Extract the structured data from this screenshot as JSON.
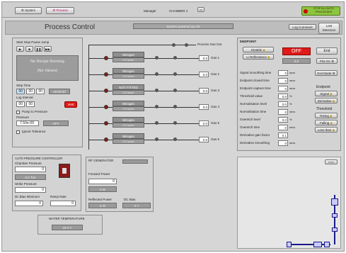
{
  "header": {
    "system_label": "System",
    "process_label": "Process",
    "manager_label": "Manager",
    "chamber": "CHAMBER 1",
    "stop_label": "STOP ALL AUTO PROCESSES"
  },
  "process": {
    "title": "Process Control",
    "status_banner": "System powered up OK",
    "log_comment": "Log Comment",
    "last_detection": "Last Detection"
  },
  "recipe": {
    "controls_label": "Start  Stop  Pause  Jump",
    "status": "No Recipe Running",
    "subtitle": "(No Values)",
    "step_time_label": "Step Time",
    "step_time": [
      "00",
      "00",
      "00"
    ],
    "step_time_total": "00:00:00",
    "log_interval_label": "Log Interval",
    "log_interval": [
      "00",
      "00"
    ],
    "vent_label": "Vent",
    "pump_label": "Pump to Pressure",
    "pressure_label": "Pressure",
    "pressure_value": "7.50e-09",
    "pressure_state": "OFF",
    "ignore_label": "Ignore Tolerance"
  },
  "gas": {
    "process_out": "Process Gas Out",
    "rows": [
      {
        "name": "Nitrogen",
        "flow": "0.0 sccm",
        "value": "0.0",
        "label": "Gas 1"
      },
      {
        "name": "Nitrogen",
        "flow": "0.0 sccm",
        "value": "0.0",
        "label": "Gas 2"
      },
      {
        "name": "NOT FITTED",
        "flow": "0.0 sccm",
        "value": "0.0",
        "label": "Gas 3"
      },
      {
        "name": "Nitrogen",
        "flow": "0.0 sccm",
        "value": "0.0",
        "label": "Gas 4"
      },
      {
        "name": "Nitrogen",
        "flow": "0.0 sccm",
        "value": "0.0",
        "label": "Gas 5"
      },
      {
        "name": "Nitrogen",
        "flow": "0.0 sccm",
        "value": "0.0",
        "label": "Gas 6"
      }
    ]
  },
  "endpoint": {
    "title": "ENDPOINT",
    "disable": "Disable",
    "li_reflectance": "Li Reflectance",
    "off": "OFF",
    "end": "End",
    "plot_on": "Plot On",
    "reading": "0.0",
    "params": [
      {
        "name": "Signal smoothing time",
        "value": "0",
        "unit": "secs"
      },
      {
        "name": "Endpoint closed time",
        "value": "0",
        "unit": "secs"
      },
      {
        "name": "Endpoint capture time",
        "value": "0",
        "unit": "secs"
      },
      {
        "name": "Threshold value",
        "value": "0.0",
        "unit": "%"
      },
      {
        "name": "Normalisation level",
        "value": "0.0",
        "unit": "%"
      },
      {
        "name": "Normalisation time",
        "value": "0",
        "unit": "secs"
      },
      {
        "name": "Overetch level",
        "value": "0.0",
        "unit": "%"
      },
      {
        "name": "Overetch time",
        "value": "0",
        "unit": "secs"
      },
      {
        "name": "Derivative gain factor",
        "value": "0.1",
        "unit": ""
      },
      {
        "name": "Derivative smoothing",
        "value": "0",
        "unit": "secs"
      }
    ],
    "exit_mode": "Exit Mode",
    "endpoint_label": "Endpoint",
    "signal": "Signal",
    "derivative": "Derivative",
    "threshold_label": "Threshold",
    "rising": "Rising",
    "falling": "Falling",
    "less_than": "Less than"
  },
  "apc": {
    "title": "AUTO PRESSURE CONTROLLER",
    "chamber_pressure_label": "Chamber Pressure",
    "chamber_pressure": "0",
    "chamber_state": "0.0 Torr",
    "strike_label": "Strike Pressure",
    "strike_value": "0",
    "dc_bias_min_label": "Dc Bias Minimum",
    "dc_bias_min": "0",
    "ramp_rate_label": "Ramp Rate",
    "ramp_rate": "0"
  },
  "rf": {
    "title": "RF GENERATOR",
    "forward_label": "Forward Power",
    "forward_value": "0",
    "forward_state": "0 W",
    "reflected_label": "Reflected Power",
    "reflected_value": "0 W",
    "dc_bias_label": "DC Bias",
    "dc_bias_value": "0 V"
  },
  "water": {
    "title": "WATER TEMPERATURE",
    "value": "29.0 C"
  },
  "colors": {
    "panel": "#d3d3d3",
    "alarm_red": "#e01a1a",
    "stop_green": "#8cc63e"
  }
}
